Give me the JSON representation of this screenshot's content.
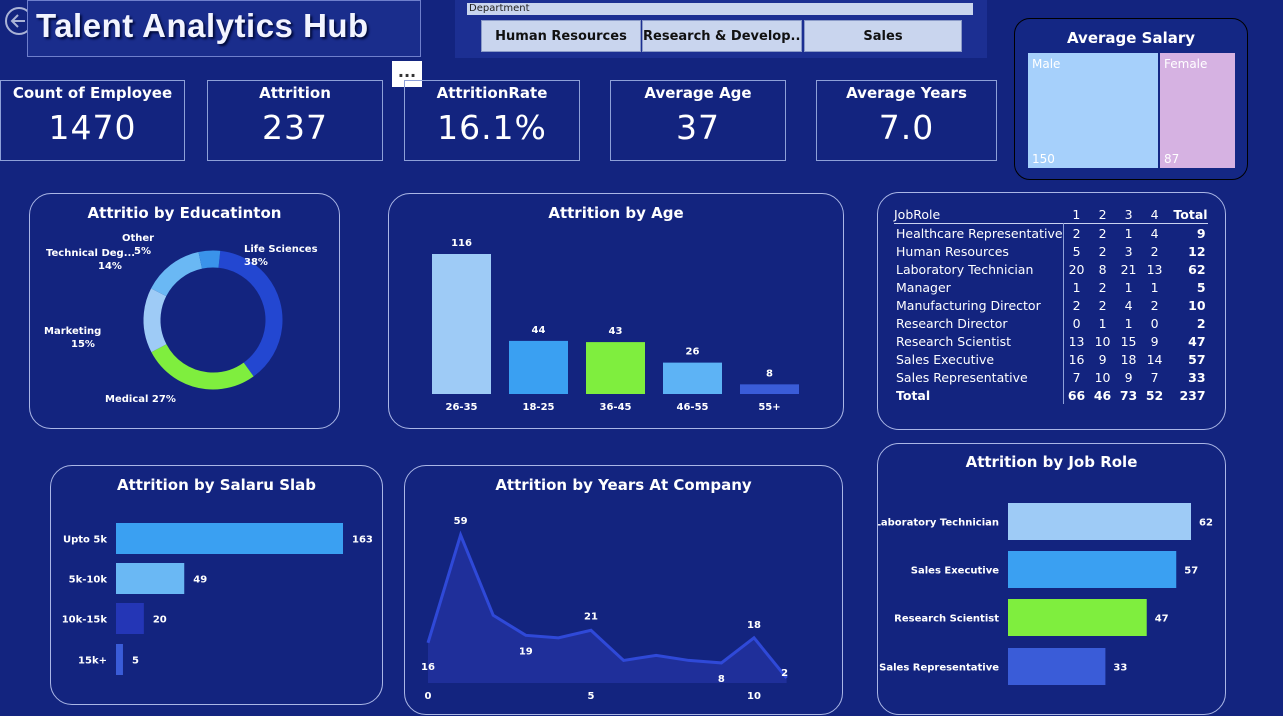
{
  "header": {
    "title": "Talent Analytics Hub",
    "more_label": "..."
  },
  "slicer": {
    "label": "Department",
    "options": [
      "Human Resources",
      "Research & Develop...",
      "Sales"
    ]
  },
  "kpis": [
    {
      "label": "Count of Employee",
      "value": "1470"
    },
    {
      "label": "Attrition",
      "value": "237"
    },
    {
      "label": "AttritionRate",
      "value": "16.1%"
    },
    {
      "label": "Average Age",
      "value": "37"
    },
    {
      "label": "Average Years",
      "value": "7.0"
    }
  ],
  "salary": {
    "title": "Average Salary",
    "male_label": "Male",
    "female_label": "Female",
    "male_value": "150",
    "female_value": "87",
    "male_color": "#a6d0fb",
    "female_color": "#d6b2e2"
  },
  "colors": {
    "bg": "#13247f",
    "light": "#9ecbf6",
    "mid": "#3aa0f2",
    "green": "#7fee3e",
    "pale": "#5db3f5",
    "deep": "#3a5cd8",
    "navy": "#2436b6"
  },
  "chart_data": [
    {
      "type": "pie",
      "title": "Attritio by Educatinton",
      "slices": [
        {
          "label": "Life Sciences",
          "pct": "38%",
          "value": 38
        },
        {
          "label": "Medical",
          "pct": "27%",
          "value": 27
        },
        {
          "label": "Marketing",
          "pct": "15%",
          "value": 15
        },
        {
          "label": "Technical Deg...",
          "pct": "14%",
          "value": 14
        },
        {
          "label": "Other",
          "pct": "5%",
          "value": 5
        }
      ]
    },
    {
      "type": "bar",
      "title": "Attrition by Age",
      "categories": [
        "26-35",
        "18-25",
        "36-45",
        "46-55",
        "55+"
      ],
      "values": [
        116,
        44,
        43,
        26,
        8
      ]
    },
    {
      "type": "table",
      "columns": [
        "JobRole",
        "1",
        "2",
        "3",
        "4",
        "Total"
      ],
      "rows": [
        [
          "Healthcare Representative",
          "2",
          "2",
          "1",
          "4",
          "9"
        ],
        [
          "Human Resources",
          "5",
          "2",
          "3",
          "2",
          "12"
        ],
        [
          "Laboratory Technician",
          "20",
          "8",
          "21",
          "13",
          "62"
        ],
        [
          "Manager",
          "1",
          "2",
          "1",
          "1",
          "5"
        ],
        [
          "Manufacturing Director",
          "2",
          "2",
          "4",
          "2",
          "10"
        ],
        [
          "Research Director",
          "0",
          "1",
          "1",
          "0",
          "2"
        ],
        [
          "Research Scientist",
          "13",
          "10",
          "15",
          "9",
          "47"
        ],
        [
          "Sales Executive",
          "16",
          "9",
          "18",
          "14",
          "57"
        ],
        [
          "Sales Representative",
          "7",
          "10",
          "9",
          "7",
          "33"
        ]
      ],
      "total": [
        "Total",
        "66",
        "46",
        "73",
        "52",
        "237"
      ]
    },
    {
      "type": "bar",
      "title": "Attrition by Salaru Slab",
      "categories": [
        "Upto 5k",
        "5k-10k",
        "10k-15k",
        "15k+"
      ],
      "values": [
        163,
        49,
        20,
        5
      ]
    },
    {
      "type": "area",
      "title": "Attrition by Years At Company",
      "x": [
        0,
        1,
        2,
        3,
        4,
        5,
        6,
        7,
        8,
        9,
        10,
        11
      ],
      "y": [
        16,
        59,
        27,
        19,
        18,
        21,
        9,
        11,
        9,
        8,
        18,
        2
      ],
      "labeled_points": [
        0,
        1,
        3,
        5,
        9,
        10,
        11
      ],
      "xticks": [
        0,
        5,
        10
      ]
    },
    {
      "type": "bar",
      "title": "Attrition by Job Role",
      "categories": [
        "Laboratory Technician",
        "Sales Executive",
        "Research Scientist",
        "Sales Representative"
      ],
      "values": [
        62,
        57,
        47,
        33
      ]
    }
  ]
}
